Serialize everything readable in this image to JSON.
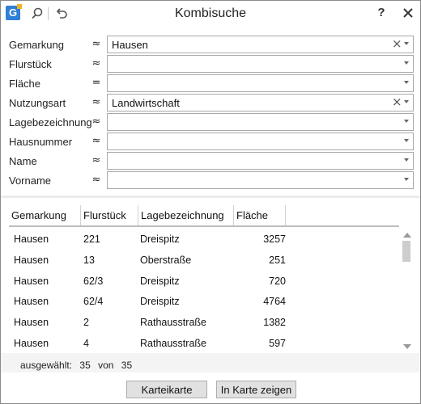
{
  "window": {
    "title": "Kombisuche",
    "help_label": "?"
  },
  "app": {
    "logo_letter": "G"
  },
  "toolbar": {
    "search_icon": "search-icon",
    "undo_icon": "undo-icon"
  },
  "form": {
    "fields": [
      {
        "label": "Gemarkung",
        "op": "≈",
        "value": "Hausen",
        "clearable": true
      },
      {
        "label": "Flurstück",
        "op": "≈",
        "value": "",
        "clearable": false
      },
      {
        "label": "Fläche",
        "op": "=",
        "value": "",
        "clearable": false
      },
      {
        "label": "Nutzungsart",
        "op": "≈",
        "value": "Landwirtschaft",
        "clearable": true
      },
      {
        "label": "Lagebezeichnung",
        "op": "≈",
        "value": "",
        "clearable": false
      },
      {
        "label": "Hausnummer",
        "op": "≈",
        "value": "",
        "clearable": false
      },
      {
        "label": "Name",
        "op": "≈",
        "value": "",
        "clearable": false
      },
      {
        "label": "Vorname",
        "op": "≈",
        "value": "",
        "clearable": false
      }
    ],
    "clear_glyph": "×"
  },
  "table": {
    "columns": [
      "Gemarkung",
      "Flurstück",
      "Lagebezeichnung",
      "Fläche"
    ],
    "rows": [
      [
        "Hausen",
        "221",
        "Dreispitz",
        "3257"
      ],
      [
        "Hausen",
        "13",
        "Oberstraße",
        "251"
      ],
      [
        "Hausen",
        "62/3",
        "Dreispitz",
        "720"
      ],
      [
        "Hausen",
        "62/4",
        "Dreispitz",
        "4764"
      ],
      [
        "Hausen",
        "2",
        "Rathausstraße",
        "1382"
      ],
      [
        "Hausen",
        "4",
        "Rathausstraße",
        "597"
      ]
    ]
  },
  "status": {
    "selected_label": "ausgewählt:",
    "selected": "35",
    "of_label": "von",
    "total": "35"
  },
  "buttons": {
    "card": "Karteikarte",
    "show_on_map": "In Karte zeigen"
  },
  "colors": {
    "logo_blue": "#2f7fd6",
    "logo_accent": "#f0b323",
    "button_bg": "#e1e1e1"
  }
}
